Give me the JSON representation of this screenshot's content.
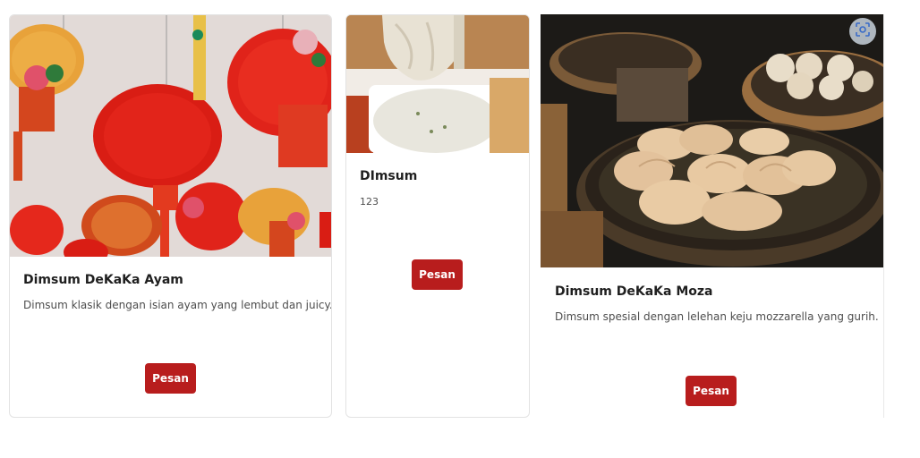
{
  "products": [
    {
      "title": "Dimsum DeKaKa Ayam",
      "description": "Dimsum klasik dengan isian ayam yang lembut dan juicy.",
      "button_label": "Pesan",
      "image_icon": "lanterns-photo"
    },
    {
      "title": "DImsum",
      "description": "123",
      "button_label": "Pesan",
      "image_icon": "dumpling-dip-photo"
    },
    {
      "title": "Dimsum DeKaKa Moza",
      "description": "Dimsum spesial dengan lelehan keju mozzarella yang gurih.",
      "button_label": "Pesan",
      "image_icon": "steamer-dimsum-photo"
    }
  ],
  "overlay": {
    "icon": "visual-search-icon"
  },
  "colors": {
    "button_bg": "#b81d1d",
    "button_text": "#ffffff"
  }
}
